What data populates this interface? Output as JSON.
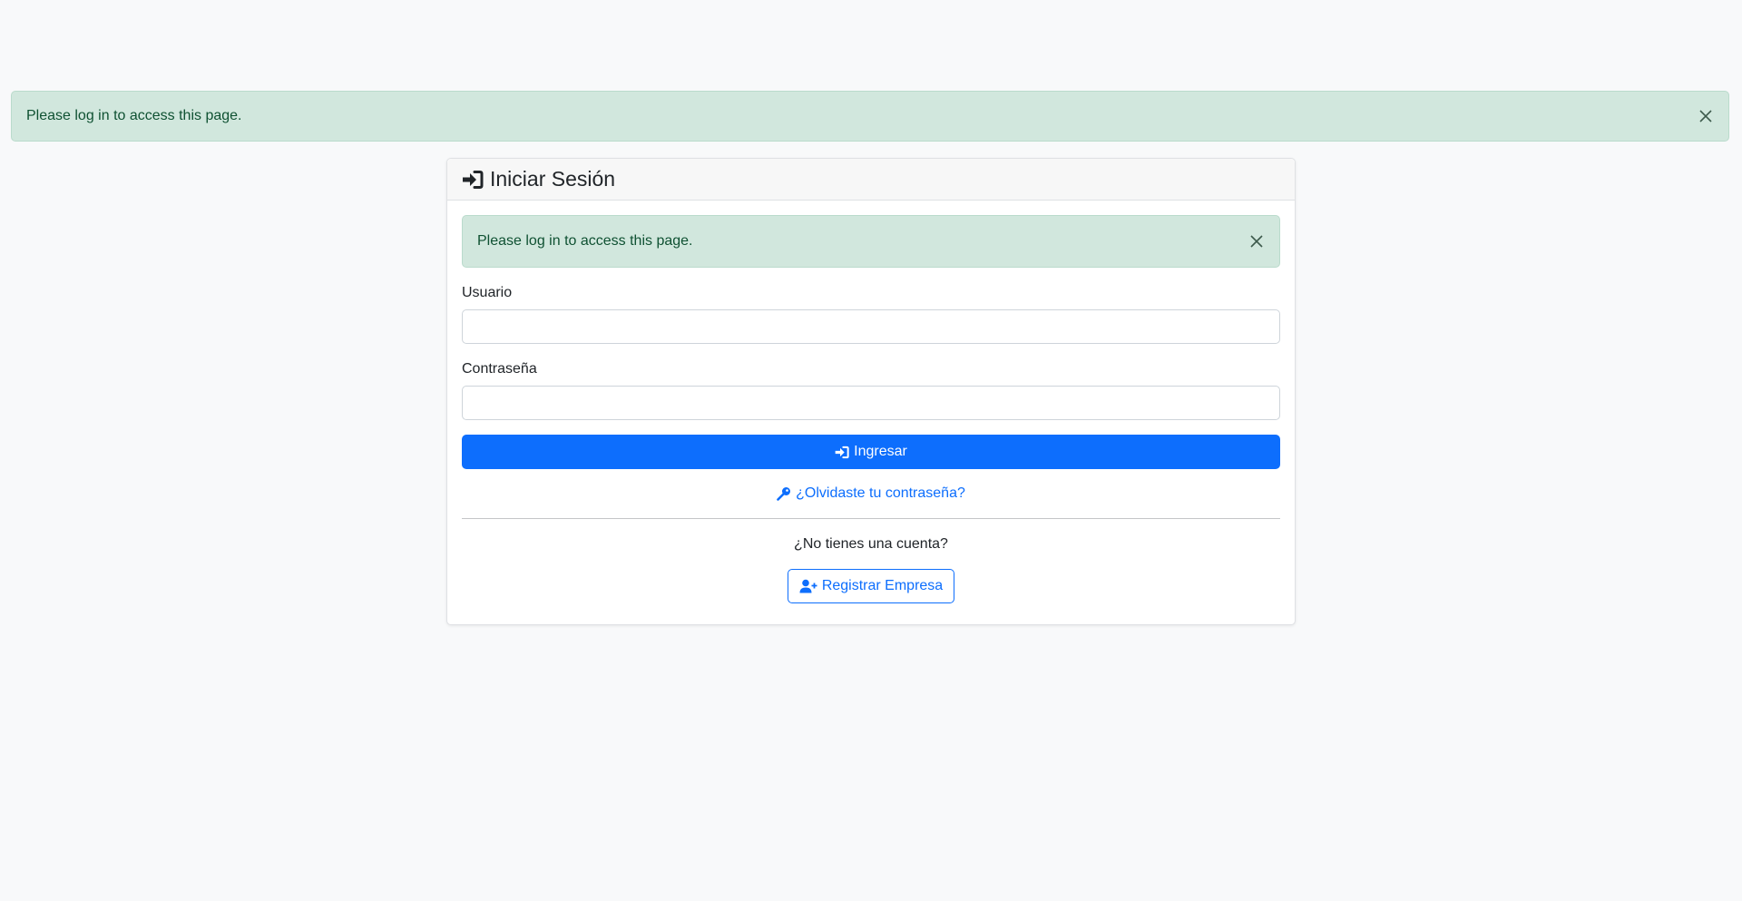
{
  "flash_top": {
    "message": "Please log in to access this page.",
    "close_icon": "close-icon"
  },
  "card": {
    "title": "Iniciar Sesión",
    "title_icon": "sign-in-icon",
    "flash": {
      "message": "Please log in to access this page.",
      "close_icon": "close-icon"
    },
    "username": {
      "label": "Usuario",
      "value": "",
      "placeholder": ""
    },
    "password": {
      "label": "Contraseña",
      "value": "",
      "placeholder": ""
    },
    "submit": {
      "label": "Ingresar",
      "icon": "sign-in-icon"
    },
    "forgot": {
      "label": "¿Olvidaste tu contraseña?",
      "icon": "key-icon"
    },
    "signup_prompt": "¿No tienes una cuenta?",
    "register": {
      "label": "Registrar Empresa",
      "icon": "user-plus-icon"
    }
  },
  "colors": {
    "page_background": "#f8f9fa",
    "alert_background": "#d1e7dd",
    "alert_text": "#0f5132",
    "primary": "#0d6efd"
  }
}
